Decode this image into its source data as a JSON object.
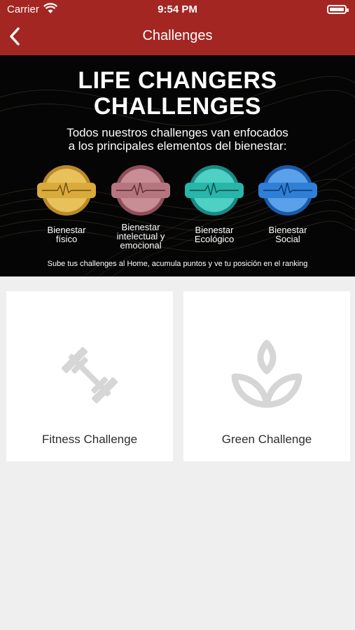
{
  "status_bar": {
    "carrier": "Carrier",
    "time": "9:54 PM"
  },
  "nav": {
    "title": "Challenges",
    "back_icon": "chevron-left-icon"
  },
  "banner": {
    "title_line1": "LIFE CHANGERS",
    "title_line2": "CHALLENGES",
    "subtitle_line1": "Todos nuestros challenges van enfocados",
    "subtitle_line2": "a los principales elementos del bienestar:",
    "medals": [
      {
        "label": "Bienestar\nfísico",
        "color": "#d9aa3c"
      },
      {
        "label": "Bienestar\nintelectual y\nemocional",
        "color": "#b67680"
      },
      {
        "label": "Bienestar\nEcológico",
        "color": "#28b5aa"
      },
      {
        "label": "Bienestar\nSocial",
        "color": "#2f7fd6"
      }
    ],
    "footer": "Sube tus challenges al Home, acumula puntos y ve tu posición en el ranking"
  },
  "cards": [
    {
      "label": "Fitness Challenge",
      "icon": "dumbbell-icon"
    },
    {
      "label": "Green Challenge",
      "icon": "leaf-icon"
    }
  ],
  "colors": {
    "nav_bg": "#a32622",
    "banner_bg": "#050505",
    "page_bg": "#efefef",
    "icon_gray": "#d6d6d6"
  }
}
